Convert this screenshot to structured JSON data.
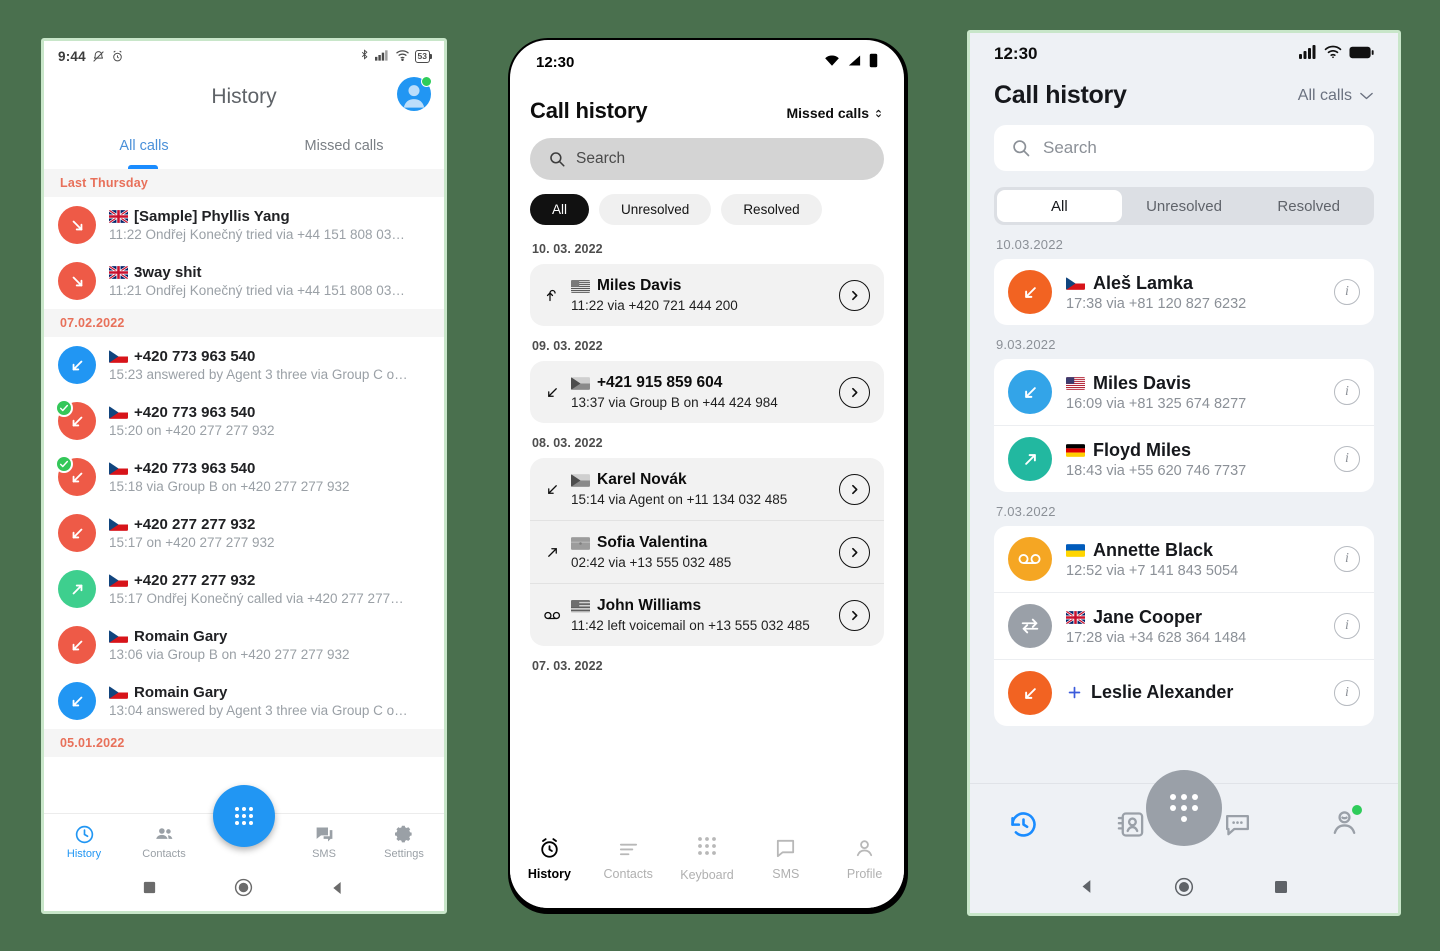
{
  "theme": {
    "page_background": "#4a704e",
    "phone_border": "#c8e6c9",
    "accent_blue": "#2196f3",
    "accent_red": "#ee5a47",
    "accent_green": "#34c759",
    "accent_orange": "#f97316",
    "accent_teal": "#22b8a0",
    "accent_gray": "#9aa0a8"
  },
  "phone1": {
    "status_bar": {
      "time": "9:44",
      "battery_percent": "53",
      "icons": [
        "mute-icon",
        "alarm-icon",
        "bluetooth-icon",
        "signal-icon",
        "wifi-icon",
        "battery-icon"
      ]
    },
    "app_bar": {
      "title": "History",
      "avatar": "profile-avatar",
      "presence": "online"
    },
    "tabs": [
      {
        "label": "All calls",
        "active": true
      },
      {
        "label": "Missed calls",
        "active": false
      }
    ],
    "groups": [
      {
        "date": "Last Thursday",
        "rows": [
          {
            "name": "[Sample] Phyllis Yang",
            "detail": "11:22 Ondřej Konečný tried via +44 151 808 03…",
            "flag": "gb",
            "direction": "missed",
            "color": "#ee5a47",
            "badge": false
          },
          {
            "name": "3way shit",
            "detail": "11:21 Ondřej Konečný tried via +44 151 808 03…",
            "flag": "gb",
            "direction": "missed",
            "color": "#ee5a47",
            "badge": false
          }
        ]
      },
      {
        "date": "07.02.2022",
        "rows": [
          {
            "name": "+420 773 963 540",
            "detail": "15:23 answered by Agent 3 three via Group C o…",
            "flag": "cz",
            "direction": "incoming",
            "color": "#2196f3",
            "badge": false
          },
          {
            "name": "+420 773 963 540",
            "detail": "15:20 on +420 277 277 932",
            "flag": "cz",
            "direction": "missed",
            "color": "#ee5a47",
            "badge": true
          },
          {
            "name": "+420 773 963 540",
            "detail": "15:18 via Group B on +420 277 277 932",
            "flag": "cz",
            "direction": "missed",
            "color": "#ee5a47",
            "badge": true
          },
          {
            "name": "+420 277 277 932",
            "detail": "15:17 on +420 277 277 932",
            "flag": "cz",
            "direction": "missed",
            "color": "#ee5a47",
            "badge": false
          },
          {
            "name": "+420 277 277 932",
            "detail": "15:17 Ondřej Konečný called via +420 277 277…",
            "flag": "cz",
            "direction": "outgoing",
            "color": "#3ecf8e",
            "badge": false
          },
          {
            "name": "Romain Gary",
            "detail": "13:06 via Group B on +420 277 277 932",
            "flag": "cz",
            "direction": "missed",
            "color": "#ee5a47",
            "badge": false
          },
          {
            "name": "Romain Gary",
            "detail": "13:04 answered by Agent 3 three via Group C o…",
            "flag": "cz",
            "direction": "incoming",
            "color": "#2196f3",
            "badge": false
          }
        ]
      },
      {
        "date": "05.01.2022",
        "rows": []
      }
    ],
    "fab": "dialpad-fab",
    "bottom_nav": [
      {
        "label": "History",
        "icon": "clock-icon",
        "active": true
      },
      {
        "label": "Contacts",
        "icon": "contacts-icon",
        "active": false
      },
      {
        "label": "SMS",
        "icon": "sms-icon",
        "active": false
      },
      {
        "label": "Settings",
        "icon": "gear-icon",
        "active": false
      }
    ],
    "system_bar": [
      "square-recents-icon",
      "circle-home-icon",
      "triangle-back-icon"
    ]
  },
  "phone2": {
    "status_bar": {
      "time": "12:30",
      "icons": [
        "wifi-icon",
        "signal-icon",
        "battery-icon"
      ]
    },
    "header": {
      "title": "Call history",
      "filter_label": "Missed calls"
    },
    "search": {
      "placeholder": "Search",
      "icon": "search-icon"
    },
    "chips": [
      {
        "label": "All",
        "active": true
      },
      {
        "label": "Unresolved",
        "active": false
      },
      {
        "label": "Resolved",
        "active": false
      }
    ],
    "groups": [
      {
        "date": "10. 03. 2022",
        "rows": [
          {
            "name": "Miles Davis",
            "detail": "11:22  via +420 721 444 200",
            "flag": "us",
            "direction": "returned"
          }
        ]
      },
      {
        "date": "09. 03. 2022",
        "rows": [
          {
            "name": "+421 915 859 604",
            "detail": "13:37  via Group B on +44 424 984",
            "flag": "cz-gray",
            "direction": "incoming"
          }
        ]
      },
      {
        "date": "08. 03. 2022",
        "rows": [
          {
            "name": "Karel Novák",
            "detail": "15:14  via Agent on +11 134 032 485",
            "flag": "cz-gray",
            "direction": "incoming"
          },
          {
            "name": "Sofia Valentina",
            "detail": "02:42  via +13 555 032 485",
            "flag": "gray",
            "direction": "outgoing"
          },
          {
            "name": "John Williams",
            "detail": "11:42  left voicemail on +13 555 032 485",
            "flag": "us-gray",
            "direction": "voicemail"
          }
        ]
      },
      {
        "date": "07. 03. 2022",
        "rows": []
      }
    ],
    "bottom_nav": [
      {
        "label": "History",
        "icon": "alarm-clock-icon",
        "active": true
      },
      {
        "label": "Contacts",
        "icon": "list-icon",
        "active": false
      },
      {
        "label": "Keyboard",
        "icon": "dialpad-icon",
        "active": false
      },
      {
        "label": "SMS",
        "icon": "chat-icon",
        "active": false
      },
      {
        "label": "Profile",
        "icon": "person-icon",
        "active": false
      }
    ]
  },
  "phone3": {
    "status_bar": {
      "time": "12:30",
      "icons": [
        "signal-icon",
        "wifi-icon",
        "battery-icon"
      ]
    },
    "header": {
      "title": "Call history",
      "filter_label": "All calls"
    },
    "search": {
      "placeholder": "Search",
      "icon": "search-icon"
    },
    "segments": [
      {
        "label": "All",
        "active": true
      },
      {
        "label": "Unresolved",
        "active": false
      },
      {
        "label": "Resolved",
        "active": false
      }
    ],
    "groups": [
      {
        "date": "10.03.2022",
        "rows": [
          {
            "name": "Aleš Lamka",
            "detail": "17:38 via +81 120 827 6232",
            "flag": "cz",
            "direction": "missed",
            "color": "#f26322"
          }
        ]
      },
      {
        "date": "9.03.2022",
        "rows": [
          {
            "name": "Miles Davis",
            "detail": "16:09 via +81 325 674 8277",
            "flag": "us",
            "direction": "incoming",
            "color": "#33a4e8"
          },
          {
            "name": "Floyd Miles",
            "detail": "18:43 via +55 620 746 7737",
            "flag": "de",
            "direction": "outgoing",
            "color": "#22b8a0"
          }
        ]
      },
      {
        "date": "7.03.2022",
        "rows": [
          {
            "name": "Annette Black",
            "detail": "12:52 via +7 141 843 5054",
            "flag": "ua",
            "direction": "voicemail",
            "color": "#f5a623"
          },
          {
            "name": "Jane Cooper",
            "detail": "17:28 via +34 628 364 1484",
            "flag": "gb",
            "direction": "transfer",
            "color": "#9aa0a8"
          },
          {
            "name": "Leslie Alexander",
            "detail": "",
            "flag": "plus",
            "direction": "missed",
            "color": "#f26322"
          }
        ]
      }
    ],
    "fab": "dialpad-fab",
    "bottom_nav": [
      {
        "icon": "history-icon",
        "active": true
      },
      {
        "icon": "contact-card-icon",
        "active": false
      },
      {
        "icon": "chat-bubble-icon",
        "active": false
      },
      {
        "icon": "profile-icon",
        "active": false
      }
    ],
    "system_bar": [
      "triangle-back-icon",
      "circle-home-icon",
      "square-recents-icon"
    ]
  }
}
